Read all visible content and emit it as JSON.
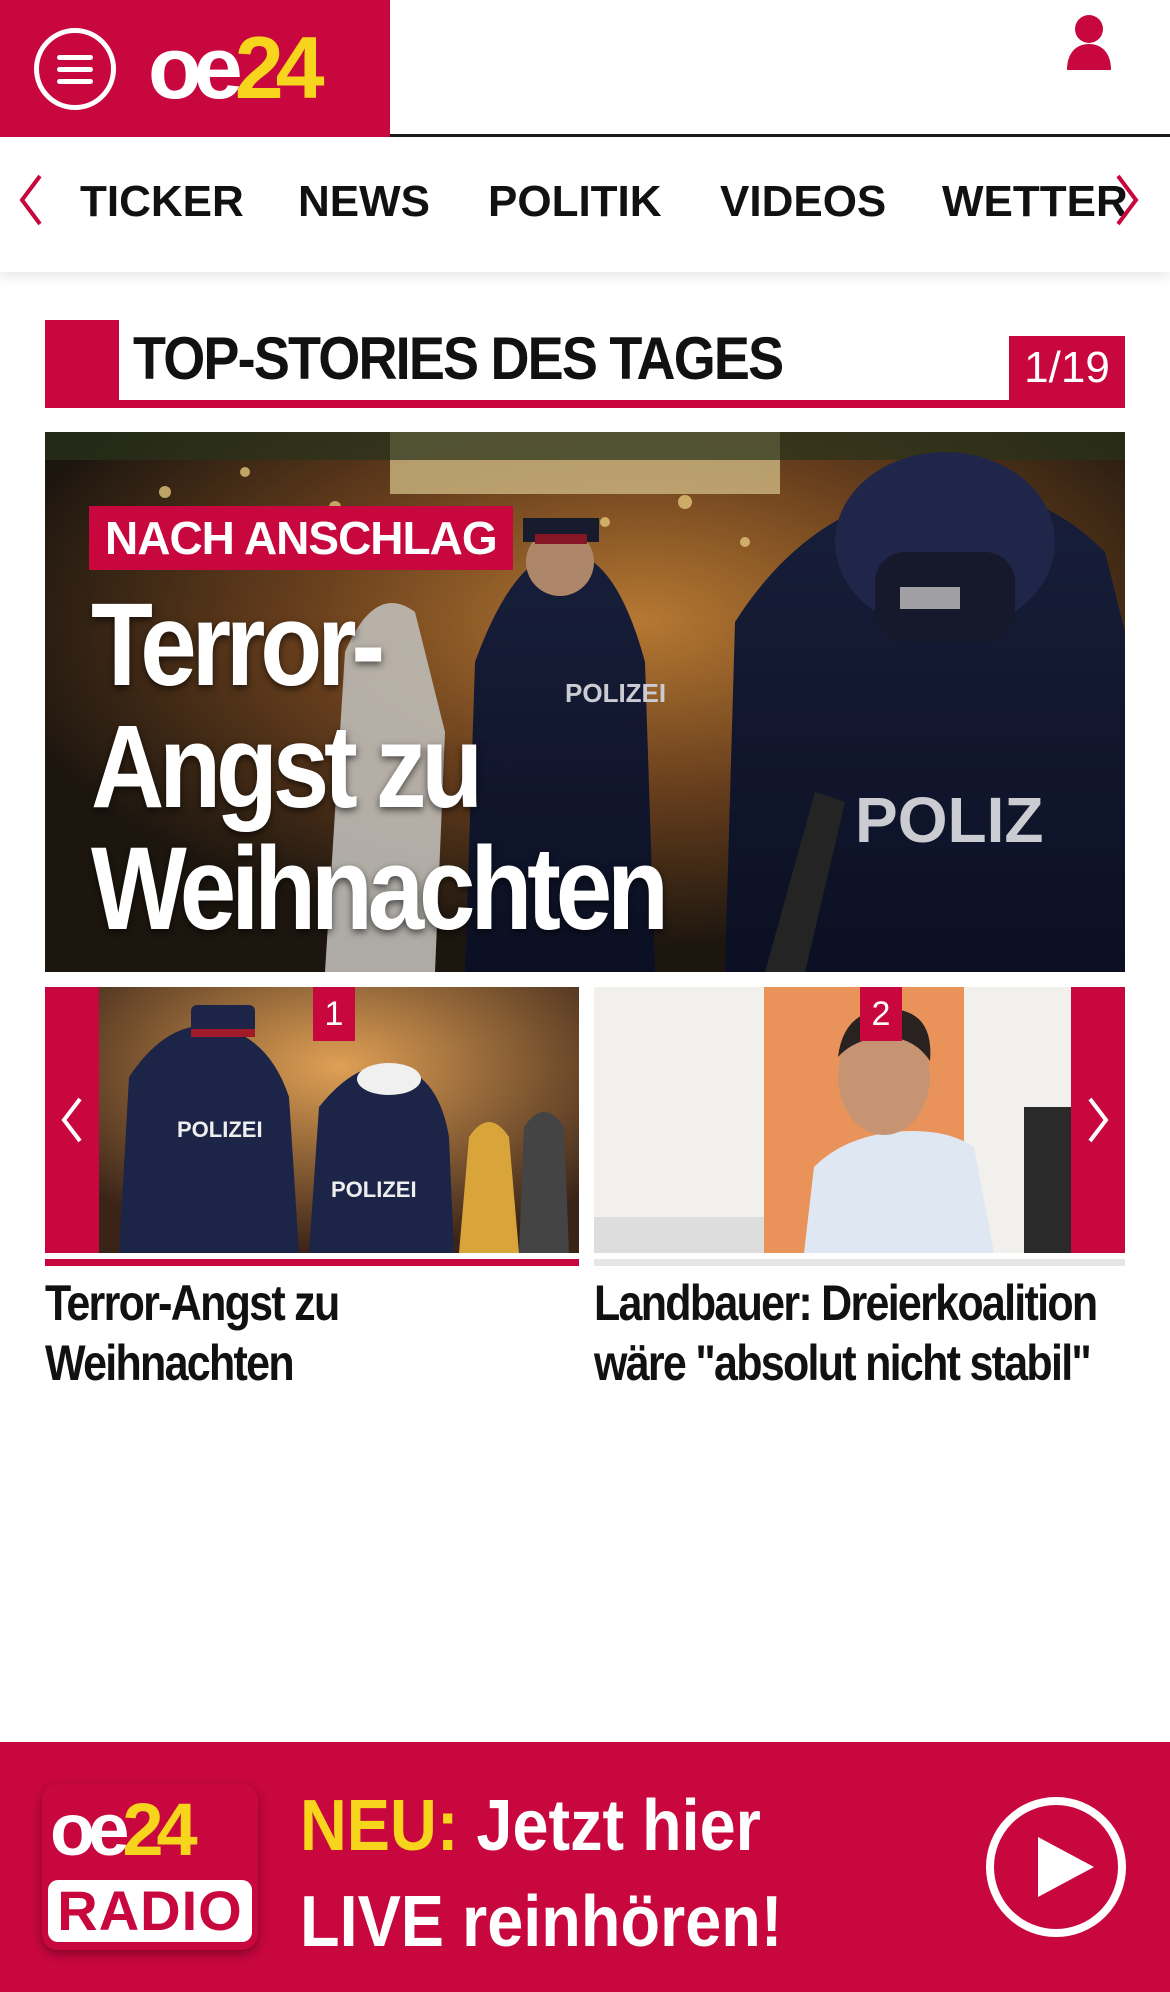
{
  "header": {
    "logo_part1": "oe",
    "logo_part2": "24",
    "menu_icon": "hamburger-menu-icon",
    "user_icon": "user-icon"
  },
  "nav": {
    "items": [
      "TICKER",
      "NEWS",
      "POLITIK",
      "VIDEOS",
      "WETTER"
    ],
    "left_arrow_icon": "chevron-left-icon",
    "right_arrow_icon": "chevron-right-icon"
  },
  "top_stories": {
    "title": "TOP-STORIES DES TAGES",
    "counter": "1/19"
  },
  "hero": {
    "kicker": "NACH ANSCHLAG",
    "title": "Terror-Angst zu Weihnachten"
  },
  "carousel": {
    "cards": [
      {
        "number": "1",
        "title": "Terror-Angst zu Weihnachten"
      },
      {
        "number": "2",
        "title": "Landbauer: Dreierkoalition wäre \"absolut nicht stabil\""
      }
    ],
    "prev_icon": "chevron-left-icon",
    "next_icon": "chevron-right-icon"
  },
  "radio_banner": {
    "logo_part1": "oe",
    "logo_part2": "24",
    "logo_sub": "RADIO",
    "neu": "NEU:",
    "line1": "Jetzt hier",
    "line2": "LIVE reinhören!",
    "play_icon": "play-icon"
  },
  "colors": {
    "brand_red": "#c8073f",
    "brand_yellow": "#f7d51d"
  }
}
